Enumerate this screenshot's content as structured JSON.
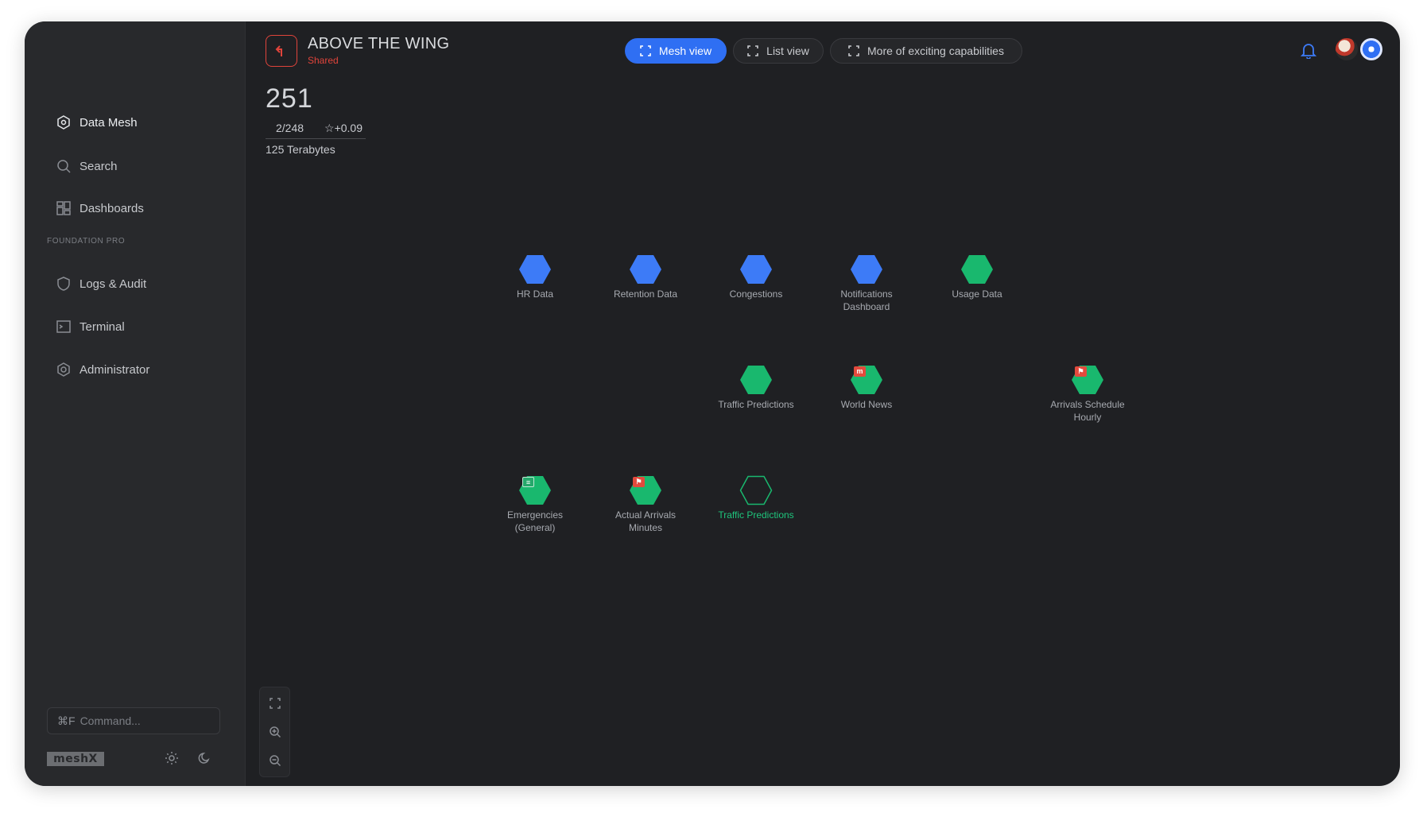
{
  "sidebar": {
    "items": [
      {
        "label": "Data Mesh",
        "icon": "data-mesh-icon"
      },
      {
        "label": "Search",
        "icon": "search-icon"
      },
      {
        "label": "Dashboards",
        "icon": "dashboards-icon"
      }
    ],
    "section_title": "FOUNDATION PRO",
    "pro_items": [
      {
        "label": "Logs & Audit",
        "icon": "shield-icon"
      },
      {
        "label": "Terminal",
        "icon": "terminal-icon"
      },
      {
        "label": "Administrator",
        "icon": "gear-icon"
      }
    ],
    "command": {
      "shortcut": "⌘F",
      "placeholder": "Command..."
    },
    "brand": "meshX"
  },
  "header": {
    "title": "ABOVE THE WING",
    "subtitle": "Shared",
    "tabs": [
      {
        "label": "Mesh view",
        "active": true
      },
      {
        "label": "List view",
        "active": false
      },
      {
        "label": "More of exciting capabilities",
        "active": false
      }
    ]
  },
  "stats": {
    "count": "251",
    "ratio": "2/248",
    "rating": "+0.09",
    "size": "125 Terabytes"
  },
  "mesh": {
    "nodes": [
      {
        "label": "HR Data",
        "color": "#3d7bf7",
        "style": "filled"
      },
      {
        "label": "Retention Data",
        "color": "#3d7bf7",
        "style": "filled"
      },
      {
        "label": "Congestions",
        "color": "#3d7bf7",
        "style": "filled"
      },
      {
        "label": "Notifications Dashboard",
        "color": "#3d7bf7",
        "style": "filled"
      },
      {
        "label": "Usage Data",
        "color": "#19b86e",
        "style": "filled"
      },
      {
        "label": "Traffic Predictions",
        "color": "#19b86e",
        "style": "filled"
      },
      {
        "label": "World News",
        "color": "#19b86e",
        "style": "filled",
        "badge": "m"
      },
      {
        "label": "Arrivals Schedule Hourly",
        "color": "#19b86e",
        "style": "filled",
        "badge": "flag"
      },
      {
        "label": "Emergencies (General)",
        "color": "#19b86e",
        "style": "filled",
        "badge": "doc"
      },
      {
        "label": "Actual Arrivals Minutes",
        "color": "#19b86e",
        "style": "filled",
        "badge": "flag"
      },
      {
        "label": "Traffic Predictions",
        "color": "#19b86e",
        "style": "outline"
      }
    ]
  },
  "colors": {
    "accent": "#2f6ff3",
    "brand_red": "#e0443b",
    "green": "#19b86e",
    "background": "#1f2023",
    "sidebar": "#28292c"
  }
}
